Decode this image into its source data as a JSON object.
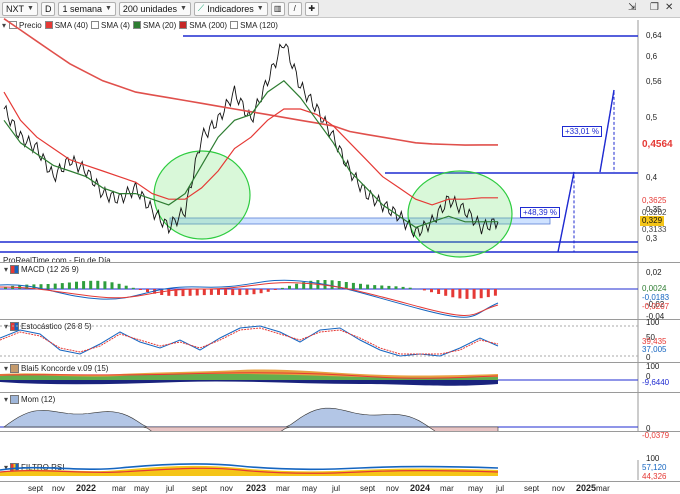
{
  "toolbar": {
    "ticker": "NXT",
    "mode_button": "D",
    "period": "1 semana",
    "units": "200 unidades",
    "indicators": "Indicadores"
  },
  "legend": [
    {
      "label": "Precio",
      "color": "#ffffff"
    },
    {
      "label": "SMA (40)",
      "color": "#e53935"
    },
    {
      "label": "SMA (4)",
      "color": "#ffffff"
    },
    {
      "label": "SMA (20)",
      "color": "#2e7d32"
    },
    {
      "label": "SMA (200)",
      "color": "#c62828"
    },
    {
      "label": "SMA (120)",
      "color": "#ffffff"
    }
  ],
  "copyright": "ProRealTime.com - Fin de Día",
  "price_axis": [
    "0,64",
    "0,6",
    "0,56",
    "0,5",
    "0,4",
    "0,35",
    "0,3"
  ],
  "price_tags": [
    {
      "text": "0,4564",
      "color": "#e53935"
    },
    {
      "text": "0,3625",
      "color": "#e53935"
    },
    {
      "text": "0,329",
      "color": "#111111",
      "bg": "#f5c518"
    },
    {
      "text": "0,3202",
      "color": "#444444"
    },
    {
      "text": "0,3133",
      "color": "#444444"
    }
  ],
  "annotations": [
    "+33,01 %",
    "+48,39 %"
  ],
  "panels": [
    {
      "title": "MACD (12 26 9)",
      "axis": [
        "0,02",
        "-0,02",
        "-0,04"
      ],
      "tags": [
        "0,0024",
        "-0,0183",
        "-0,0207"
      ]
    },
    {
      "title": "Estocástico (26 8 5)",
      "axis": [
        "100",
        "50",
        "0"
      ],
      "tags": [
        "39,435",
        "37,005"
      ]
    },
    {
      "title": "Blai5 Koncorde v.09 (15)",
      "axis": [
        "100",
        "0"
      ],
      "tags": [
        "-9,6440"
      ]
    },
    {
      "title": "Mom (12)",
      "axis": [
        "0"
      ],
      "tags": [
        "-0,0379"
      ]
    },
    {
      "title": "FILTRO RSI",
      "axis": [
        "100"
      ],
      "tags": [
        "57,120",
        "44,326"
      ]
    }
  ],
  "time_axis": {
    "months": [
      "sept",
      "nov",
      "mar",
      "may",
      "jul",
      "sept",
      "nov",
      "mar",
      "may",
      "jul",
      "sept",
      "nov",
      "mar",
      "may",
      "jul",
      "sept",
      "nov",
      "mar"
    ],
    "years": [
      "2022",
      "2023",
      "2024",
      "2025"
    ]
  },
  "chart_data": {
    "type": "line",
    "series": [
      {
        "name": "Precio",
        "values": [
          0.52,
          0.47,
          0.45,
          0.4,
          0.43,
          0.41,
          0.37,
          0.36,
          0.38,
          0.34,
          0.31,
          0.34,
          0.47,
          0.5,
          0.55,
          0.5,
          0.57,
          0.64,
          0.56,
          0.52,
          0.47,
          0.41,
          0.37,
          0.35,
          0.33,
          0.3,
          0.32,
          0.36,
          0.34,
          0.31,
          0.32
        ]
      },
      {
        "name": "SMA (200)",
        "values": [
          0.68,
          0.66,
          0.64,
          0.62,
          0.6,
          0.585,
          0.57,
          0.56,
          0.55,
          0.545,
          0.54,
          0.535,
          0.53,
          0.525,
          0.52,
          0.515,
          0.51,
          0.505,
          0.5,
          0.495,
          0.49,
          0.48,
          0.475,
          0.47,
          0.465,
          0.46,
          0.458,
          0.457,
          0.456,
          0.4564,
          0.4564
        ]
      },
      {
        "name": "SMA (40)",
        "values": [
          0.55,
          0.5,
          0.47,
          0.45,
          0.43,
          0.42,
          0.41,
          0.4,
          0.39,
          0.37,
          0.36,
          0.36,
          0.38,
          0.41,
          0.45,
          0.47,
          0.5,
          0.52,
          0.52,
          0.51,
          0.49,
          0.46,
          0.43,
          0.4,
          0.38,
          0.36,
          0.35,
          0.36,
          0.36,
          0.3625,
          0.3625
        ]
      },
      {
        "name": "SMA (20)",
        "values": [
          0.5,
          0.46,
          0.44,
          0.42,
          0.41,
          0.4,
          0.38,
          0.37,
          0.37,
          0.36,
          0.35,
          0.37,
          0.42,
          0.47,
          0.5,
          0.51,
          0.55,
          0.57,
          0.54,
          0.5,
          0.46,
          0.41,
          0.38,
          0.35,
          0.33,
          0.31,
          0.32,
          0.33,
          0.32,
          0.32,
          0.3202
        ]
      }
    ],
    "ylim": [
      0.27,
      0.66
    ]
  }
}
